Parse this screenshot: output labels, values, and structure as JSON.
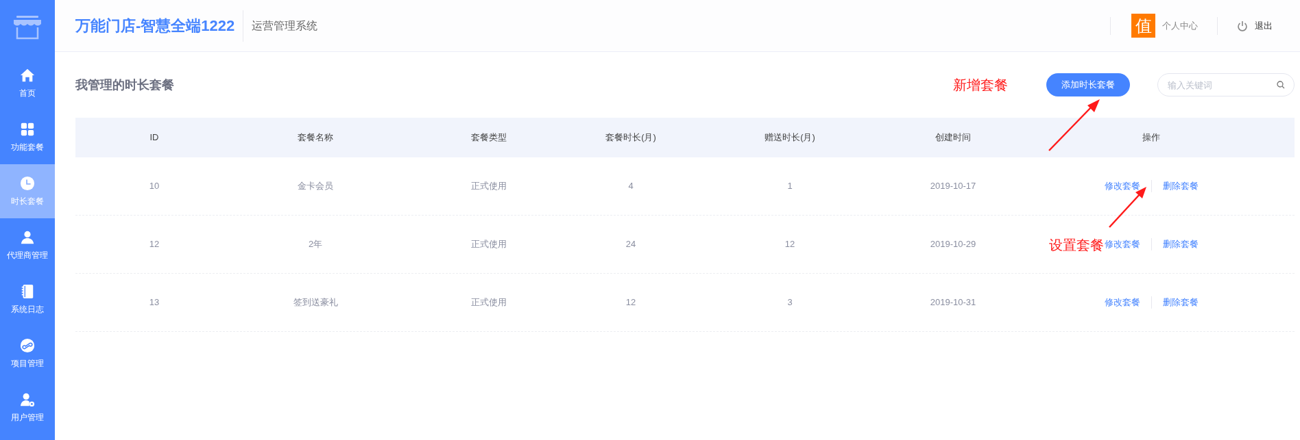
{
  "sidebar": {
    "items": [
      {
        "label": "首页",
        "selected": false
      },
      {
        "label": "功能套餐",
        "selected": false
      },
      {
        "label": "时长套餐",
        "selected": true
      },
      {
        "label": "代理商管理",
        "selected": false
      },
      {
        "label": "系统日志",
        "selected": false
      },
      {
        "label": "项目管理",
        "selected": false
      },
      {
        "label": "用户管理",
        "selected": false
      }
    ]
  },
  "header": {
    "brand": "万能门店-智慧全端1222",
    "subtitle": "运营管理系统",
    "avatar_char": "值",
    "profile": "个人中心",
    "logout": "退出"
  },
  "page": {
    "title": "我管理的时长套餐",
    "add_button": "添加时长套餐",
    "search": {
      "placeholder": "输入关键词"
    }
  },
  "table": {
    "columns": [
      "ID",
      "套餐名称",
      "套餐类型",
      "套餐时长(月)",
      "赠送时长(月)",
      "创建时间",
      "操作"
    ],
    "rows": [
      {
        "cells": [
          "10",
          "金卡会员",
          "正式使用",
          "4",
          "1",
          "2019-10-17"
        ],
        "actions": [
          "修改套餐",
          "删除套餐"
        ]
      },
      {
        "cells": [
          "12",
          "2年",
          "正式使用",
          "24",
          "12",
          "2019-10-29"
        ],
        "actions": [
          "修改套餐",
          "删除套餐"
        ]
      },
      {
        "cells": [
          "13",
          "签到送豪礼",
          "正式使用",
          "12",
          "3",
          "2019-10-31"
        ],
        "actions": [
          "修改套餐",
          "删除套餐"
        ]
      }
    ]
  },
  "annotations": [
    {
      "text": "新增套餐"
    },
    {
      "text": "设置套餐"
    }
  ]
}
